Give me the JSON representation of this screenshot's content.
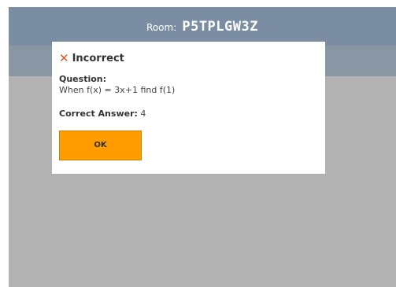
{
  "header": {
    "room_label": "Room:",
    "room_code": "P5TPLGW3Z"
  },
  "modal": {
    "icon": "close-x-icon",
    "icon_glyph": "✕",
    "title": "Incorrect",
    "question_label": "Question:",
    "question_text": "When f(x) = 3x+1 find f(1)",
    "answer_label": "Correct Answer:",
    "answer_value": "4",
    "ok_label": "OK"
  },
  "colors": {
    "header_bg": "#7a8da3",
    "overlay_bg": "#b2b2b2",
    "error_accent": "#e8541e",
    "button_bg": "#ff9c00"
  }
}
